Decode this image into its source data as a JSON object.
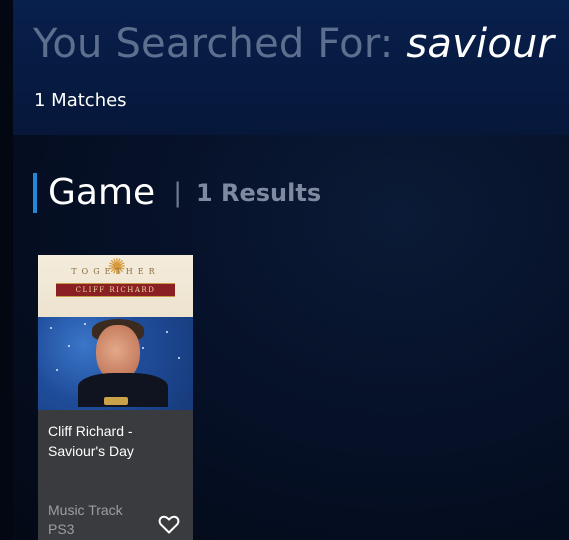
{
  "search": {
    "prefix": "You Searched For: ",
    "query": "saviour",
    "matches": "1 Matches"
  },
  "section": {
    "title": "Game",
    "separator": "|",
    "count": "1 Results"
  },
  "results": [
    {
      "title": "Cliff Richard - Saviour's Day",
      "type": "Music Track",
      "platform": "PS3",
      "cover_art_text": {
        "top": "TOGETHER",
        "banner": "CLIFF RICHARD"
      },
      "favorite_icon": "heart-outline-icon"
    }
  ],
  "colors": {
    "background": "#061128",
    "header": "#08204d",
    "accent": "#1f88d8",
    "card": "#3a3b3e"
  }
}
